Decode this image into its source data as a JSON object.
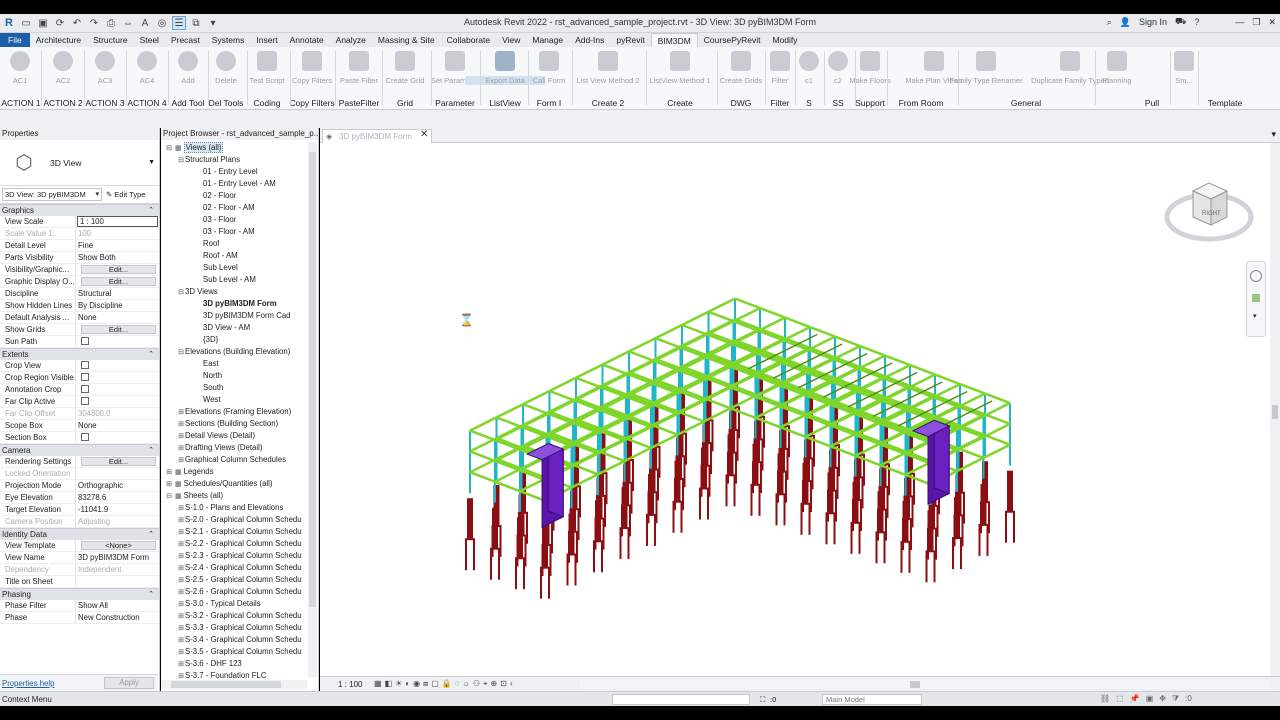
{
  "app": {
    "title": "Autodesk Revit 2022 - rst_advanced_sample_project.rvt - 3D View: 3D pyBIM3DM Form",
    "sign_in": "Sign In",
    "logo_letter": "R"
  },
  "menu": {
    "tabs": [
      "File",
      "Architecture",
      "Structure",
      "Steel",
      "Precast",
      "Systems",
      "Insert",
      "Annotate",
      "Analyze",
      "Massing & Site",
      "Collaborate",
      "View",
      "Manage",
      "Add-Ins",
      "pyRevit",
      "BIM3DM",
      "CoursePyRevit",
      "Modify"
    ],
    "active": "BIM3DM"
  },
  "ribbon": {
    "buttons": [
      {
        "label": "AC1"
      },
      {
        "label": "AC2"
      },
      {
        "label": "AC3"
      },
      {
        "label": "AC4"
      },
      {
        "label": "Add"
      },
      {
        "label": "Delete"
      },
      {
        "label": "Test Script"
      },
      {
        "label": "Copy Filters"
      },
      {
        "label": "Paste Filter"
      },
      {
        "label": "Create Grid"
      },
      {
        "label": "Set Parameter"
      },
      {
        "label": "Export Data"
      },
      {
        "label": "Call Form"
      },
      {
        "label": "List View Method 2"
      },
      {
        "label": "ListView Method 1"
      },
      {
        "label": "Create Grids"
      },
      {
        "label": "Filter"
      },
      {
        "label": "c1"
      },
      {
        "label": "c2"
      },
      {
        "label": "Make Floors"
      },
      {
        "label": "Make Plan Views"
      },
      {
        "label": "Family Type Renamer"
      },
      {
        "label": "Duplicate Family Typed"
      },
      {
        "label": "Planning"
      },
      {
        "label": "Sm..."
      }
    ],
    "groups": [
      "ACTION 1",
      "ACTION 2",
      "ACTION 3",
      "ACTION 4",
      "Add Tool",
      "Del Tools",
      "Coding",
      "Copy Filters",
      "PasteFilter",
      "Grid",
      "Parameter",
      "ListView",
      "Form I",
      "Create 2",
      "Create",
      "DWG",
      "Filter",
      "S",
      "SS",
      "Support",
      "From Room",
      "General",
      "Pull",
      "Template"
    ]
  },
  "properties": {
    "header": "Properties",
    "type_name": "3D View",
    "instance_selector": "3D View: 3D pyBIM3DM",
    "edit_type": "Edit Type",
    "sections": [
      {
        "title": "Graphics",
        "rows": [
          {
            "k": "View Scale",
            "v": "1 : 100",
            "kind": "input"
          },
          {
            "k": "Scale Value    1:",
            "v": "100",
            "kind": "dim"
          },
          {
            "k": "Detail Level",
            "v": "Fine"
          },
          {
            "k": "Parts Visibility",
            "v": "Show Both"
          },
          {
            "k": "Visibility/Graphic...",
            "v": "Edit...",
            "kind": "btn"
          },
          {
            "k": "Graphic Display O...",
            "v": "Edit...",
            "kind": "btn"
          },
          {
            "k": "Discipline",
            "v": "Structural"
          },
          {
            "k": "Show Hidden Lines",
            "v": "By Discipline"
          },
          {
            "k": "Default Analysis ...",
            "v": "None"
          },
          {
            "k": "Show Grids",
            "v": "Edit...",
            "kind": "btn"
          },
          {
            "k": "Sun Path",
            "v": "",
            "kind": "chk"
          }
        ]
      },
      {
        "title": "Extents",
        "rows": [
          {
            "k": "Crop View",
            "v": "",
            "kind": "chk"
          },
          {
            "k": "Crop Region Visible",
            "v": "",
            "kind": "chk"
          },
          {
            "k": "Annotation Crop",
            "v": "",
            "kind": "chk"
          },
          {
            "k": "Far Clip Active",
            "v": "",
            "kind": "chk"
          },
          {
            "k": "Far Clip Offset",
            "v": "304800.0",
            "kind": "dim"
          },
          {
            "k": "Scope Box",
            "v": "None"
          },
          {
            "k": "Section Box",
            "v": "",
            "kind": "chk"
          }
        ]
      },
      {
        "title": "Camera",
        "rows": [
          {
            "k": "Rendering Settings",
            "v": "Edit...",
            "kind": "btn"
          },
          {
            "k": "Locked Orientation",
            "v": "",
            "kind": "dim"
          },
          {
            "k": "Projection Mode",
            "v": "Orthographic"
          },
          {
            "k": "Eye Elevation",
            "v": "83278.6"
          },
          {
            "k": "Target Elevation",
            "v": "-11041.9"
          },
          {
            "k": "Camera Position",
            "v": "Adjusting",
            "kind": "dim"
          }
        ]
      },
      {
        "title": "Identity Data",
        "rows": [
          {
            "k": "View Template",
            "v": "<None>",
            "kind": "btn"
          },
          {
            "k": "View Name",
            "v": "3D pyBIM3DM Form"
          },
          {
            "k": "Dependency",
            "v": "Independent",
            "kind": "dim"
          },
          {
            "k": "Title on Sheet",
            "v": ""
          }
        ]
      },
      {
        "title": "Phasing",
        "rows": [
          {
            "k": "Phase Filter",
            "v": "Show All"
          },
          {
            "k": "Phase",
            "v": "New Construction"
          }
        ]
      }
    ],
    "help_link": "Properties help",
    "apply": "Apply"
  },
  "browser": {
    "title": "Project Browser - rst_advanced_sample_p...",
    "items": [
      {
        "t": "Views (all)",
        "lvl": 0,
        "tw": "−",
        "sel": true
      },
      {
        "t": "Structural Plans",
        "lvl": 1,
        "tw": "−"
      },
      {
        "t": "01 - Entry Level",
        "lvl": 2
      },
      {
        "t": "01 - Entry Level - AM",
        "lvl": 2
      },
      {
        "t": "02 - Floor",
        "lvl": 2
      },
      {
        "t": "02 - Floor - AM",
        "lvl": 2
      },
      {
        "t": "03 - Floor",
        "lvl": 2
      },
      {
        "t": "03 - Floor - AM",
        "lvl": 2
      },
      {
        "t": "Roof",
        "lvl": 2
      },
      {
        "t": "Roof - AM",
        "lvl": 2
      },
      {
        "t": "Sub Level",
        "lvl": 2
      },
      {
        "t": "Sub Level - AM",
        "lvl": 2
      },
      {
        "t": "3D Views",
        "lvl": 1,
        "tw": "−"
      },
      {
        "t": "3D pyBIM3DM Form",
        "lvl": 2,
        "bold": true
      },
      {
        "t": "3D pyBIM3DM Form Cad",
        "lvl": 2
      },
      {
        "t": "3D View - AM",
        "lvl": 2
      },
      {
        "t": "{3D}",
        "lvl": 2
      },
      {
        "t": "Elevations (Building Elevation)",
        "lvl": 1,
        "tw": "−"
      },
      {
        "t": "East",
        "lvl": 2
      },
      {
        "t": "North",
        "lvl": 2
      },
      {
        "t": "South",
        "lvl": 2
      },
      {
        "t": "West",
        "lvl": 2
      },
      {
        "t": "Elevations (Framing Elevation)",
        "lvl": 1,
        "tw": "+"
      },
      {
        "t": "Sections (Building Section)",
        "lvl": 1,
        "tw": "+"
      },
      {
        "t": "Detail Views (Detail)",
        "lvl": 1,
        "tw": "+"
      },
      {
        "t": "Drafting Views (Detail)",
        "lvl": 1,
        "tw": "+"
      },
      {
        "t": "Graphical Column Schedules",
        "lvl": 1,
        "tw": "+"
      },
      {
        "t": "Legends",
        "lvl": 0,
        "tw": "+"
      },
      {
        "t": "Schedules/Quantities (all)",
        "lvl": 0,
        "tw": "+"
      },
      {
        "t": "Sheets (all)",
        "lvl": 0,
        "tw": "−"
      },
      {
        "t": "S-1.0 - Plans and Elevations",
        "lvl": 1,
        "tw": "+"
      },
      {
        "t": "S-2.0 - Graphical Column Schedu",
        "lvl": 1,
        "tw": "+"
      },
      {
        "t": "S-2.1 - Graphical Column Schedu",
        "lvl": 1,
        "tw": "+"
      },
      {
        "t": "S-2.2 - Graphical Column Schedu",
        "lvl": 1,
        "tw": "+"
      },
      {
        "t": "S-2.3 - Graphical Column Schedu",
        "lvl": 1,
        "tw": "+"
      },
      {
        "t": "S-2.4 - Graphical Column Schedu",
        "lvl": 1,
        "tw": "+"
      },
      {
        "t": "S-2.5 - Graphical Column Schedu",
        "lvl": 1,
        "tw": "+"
      },
      {
        "t": "S-2.6 - Graphical Column Schedu",
        "lvl": 1,
        "tw": "+"
      },
      {
        "t": "S-3.0 - Typical Details",
        "lvl": 1,
        "tw": "+"
      },
      {
        "t": "S-3.2 - Graphical Column Schedu",
        "lvl": 1,
        "tw": "+"
      },
      {
        "t": "S-3.3 - Graphical Column Schedu",
        "lvl": 1,
        "tw": "+"
      },
      {
        "t": "S-3.4 - Graphical Column Schedu",
        "lvl": 1,
        "tw": "+"
      },
      {
        "t": "S-3.5 - Graphical Column Schedu",
        "lvl": 1,
        "tw": "+"
      },
      {
        "t": "S-3.6 - DHF 123",
        "lvl": 1,
        "tw": "+"
      },
      {
        "t": "S-3.7 - Foundation FLC",
        "lvl": 1,
        "tw": "+"
      }
    ]
  },
  "view": {
    "tab_label": "3D pyBIM3DM Form",
    "scale": "1 : 100",
    "viewcube_label": "RIGHT",
    "colors": {
      "beam": "#7fd62a",
      "column": "#1fb6c9",
      "footing": "#8b0f12",
      "wall": "#6a1fbf"
    }
  },
  "status": {
    "left": "Context Menu",
    "selection_count": ":0",
    "workset": "Main Model"
  }
}
